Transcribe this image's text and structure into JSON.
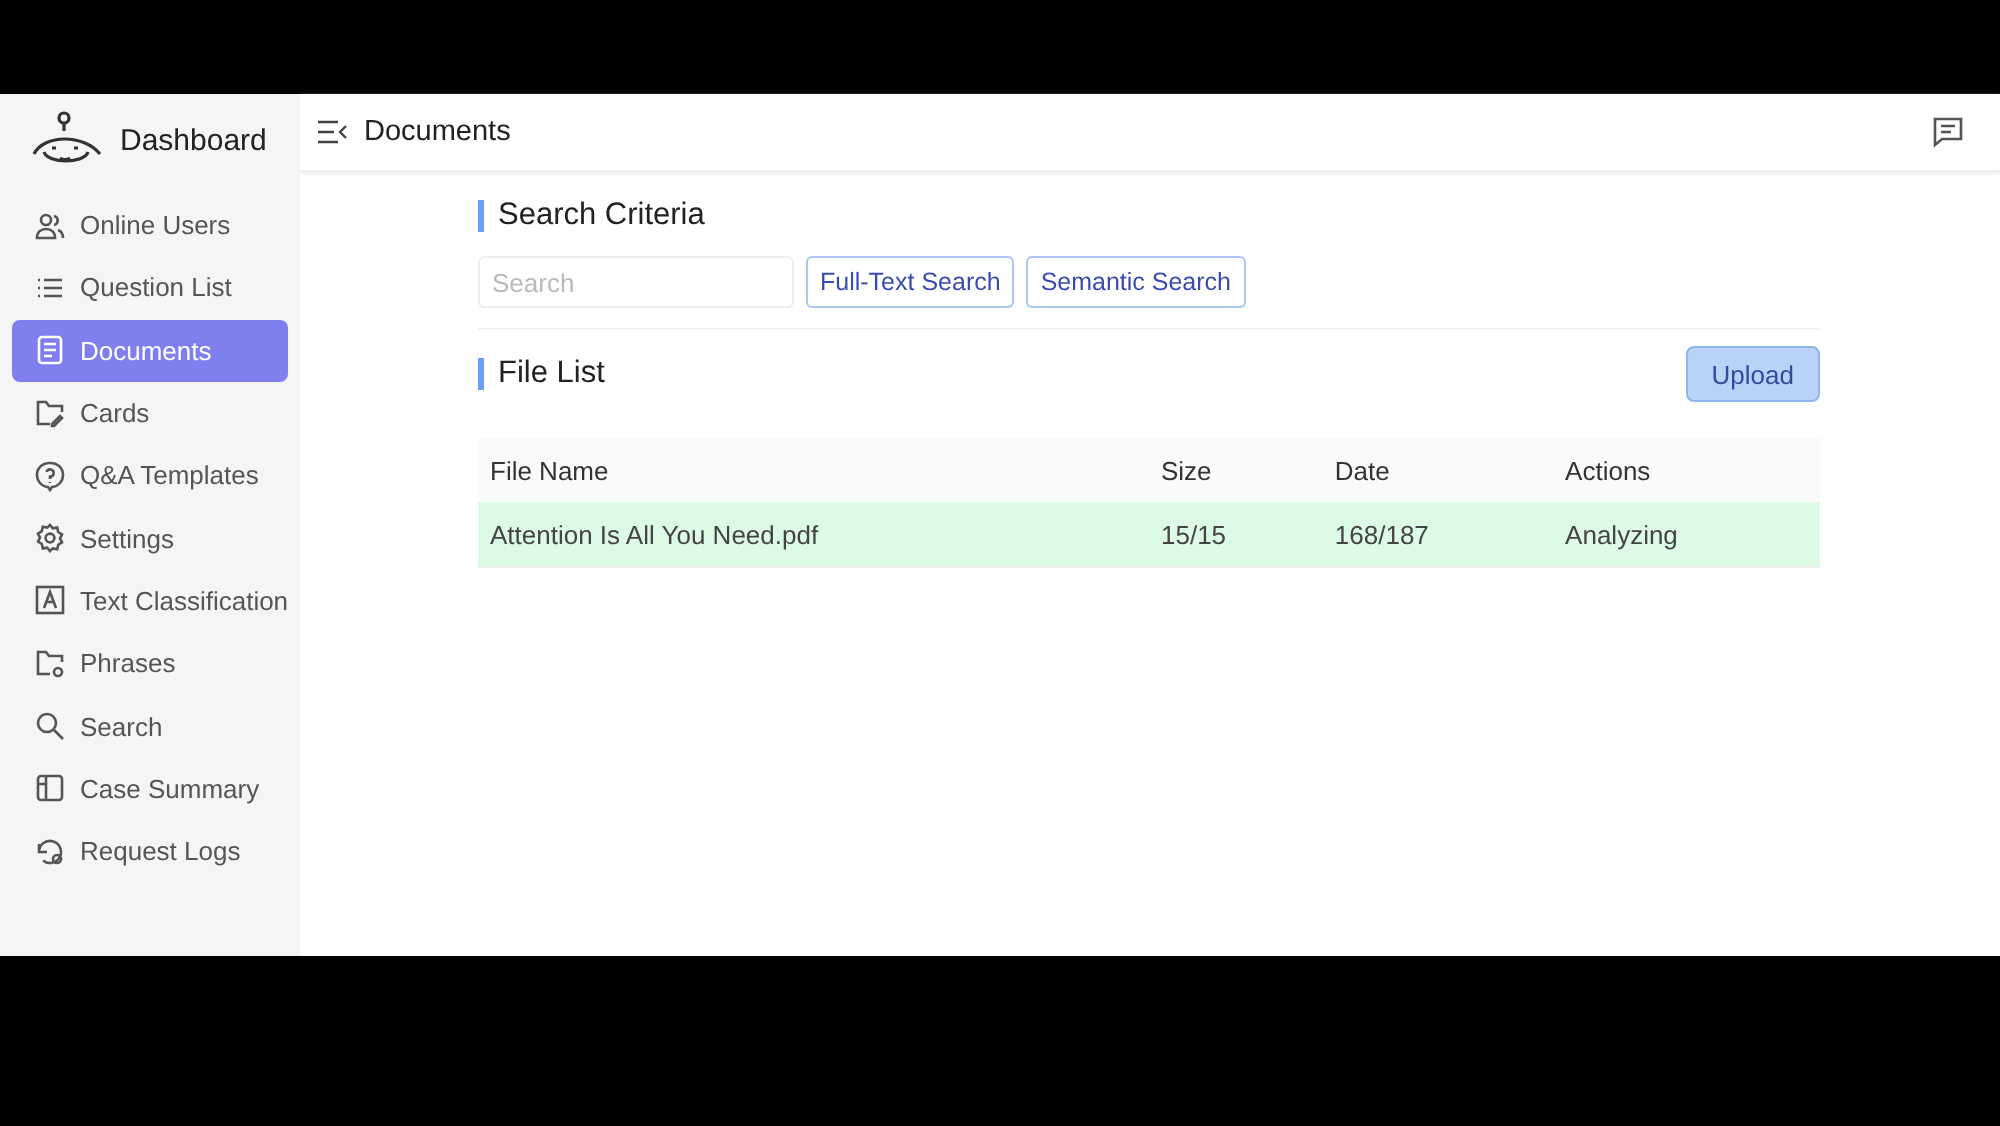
{
  "sidebar": {
    "brand": "Dashboard",
    "items": [
      {
        "label": "Online Users",
        "selected": false
      },
      {
        "label": "Question List",
        "selected": false
      },
      {
        "label": "Documents",
        "selected": true
      },
      {
        "label": "Cards",
        "selected": false
      },
      {
        "label": "Q&A Templates",
        "selected": false
      },
      {
        "label": "Settings",
        "selected": false
      },
      {
        "label": "Text Classification",
        "selected": false
      },
      {
        "label": "Phrases",
        "selected": false
      },
      {
        "label": "Search",
        "selected": false
      },
      {
        "label": "Case Summary",
        "selected": false
      },
      {
        "label": "Request Logs",
        "selected": false
      }
    ]
  },
  "header": {
    "title": "Documents"
  },
  "search_criteria": {
    "title": "Search Criteria",
    "search": {
      "placeholder": "Search"
    },
    "buttons": [
      "Full-Text Search",
      "Semantic Search"
    ]
  },
  "file_list": {
    "title": "File List",
    "upload": "Upload",
    "columns": [
      "File Name",
      "Size",
      "Date",
      "Actions"
    ],
    "rows": [
      {
        "cells": [
          "Attention Is All You Need.pdf",
          "15/15",
          "168/187",
          "Analyzing"
        ],
        "highlighted": true
      }
    ]
  }
}
